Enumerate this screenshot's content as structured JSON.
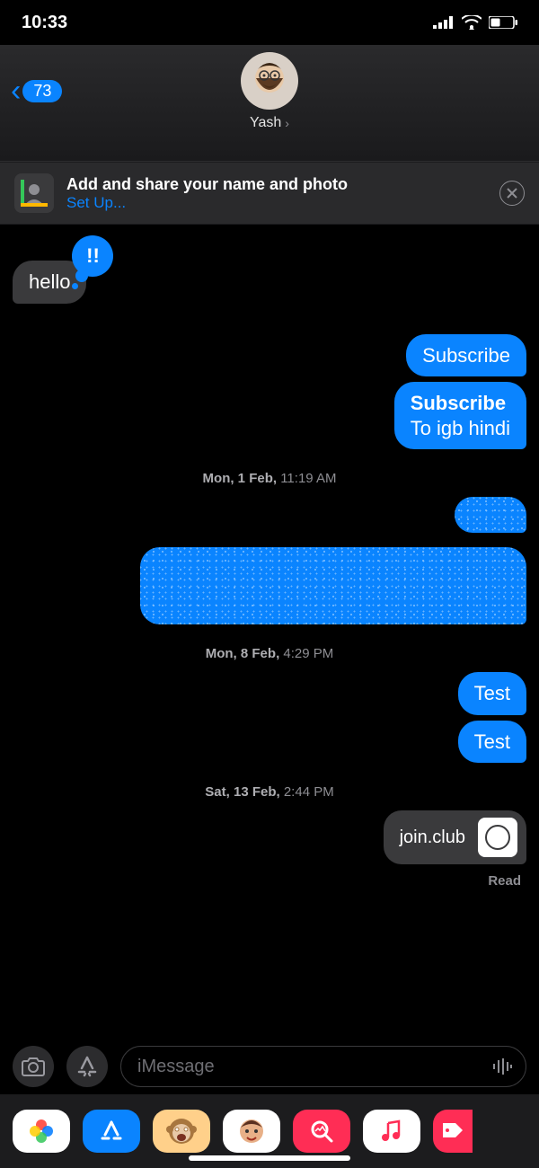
{
  "status": {
    "time": "10:33"
  },
  "header": {
    "back_count": "73",
    "contact_name": "Yash"
  },
  "banner": {
    "title": "Add and share your name and photo",
    "action": "Set Up..."
  },
  "messages": {
    "m1": "hello",
    "tapback1": "!!",
    "m2": "Subscribe",
    "m3_bold": "Subscribe",
    "m3_rest": "To igb hindi",
    "ts1_date": "Mon, 1 Feb,",
    "ts1_time": " 11:19 AM",
    "ts2_date": "Mon, 8 Feb,",
    "ts2_time": " 4:29 PM",
    "m4": "Test",
    "m5": "Test",
    "ts3_date": "Sat, 13 Feb,",
    "ts3_time": " 2:44 PM",
    "link_text": "join.club",
    "read_status": "Read"
  },
  "compose": {
    "placeholder": "iMessage"
  }
}
